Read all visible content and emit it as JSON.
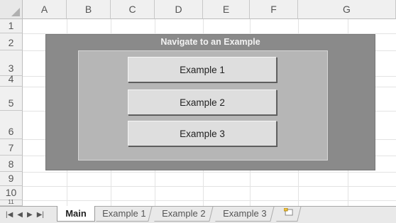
{
  "columns": [
    "A",
    "B",
    "C",
    "D",
    "E",
    "F",
    "G"
  ],
  "rows": [
    "1",
    "2",
    "3",
    "4",
    "5",
    "6",
    "7",
    "8",
    "9",
    "10",
    "11"
  ],
  "panel": {
    "title": "Navigate to an Example",
    "buttons": [
      "Example 1",
      "Example 2",
      "Example 3"
    ]
  },
  "tabs": {
    "nav": [
      "first-sheet-icon",
      "prev-sheet-icon",
      "next-sheet-icon",
      "last-sheet-icon"
    ],
    "sheets": [
      "Main",
      "Example 1",
      "Example 2",
      "Example 3"
    ],
    "active": "Main",
    "insert_icon": "insert-sheet-icon"
  },
  "colors": {
    "panel": "#8a8a8a",
    "inner": "#b6b6b6",
    "button": "#dedede"
  }
}
